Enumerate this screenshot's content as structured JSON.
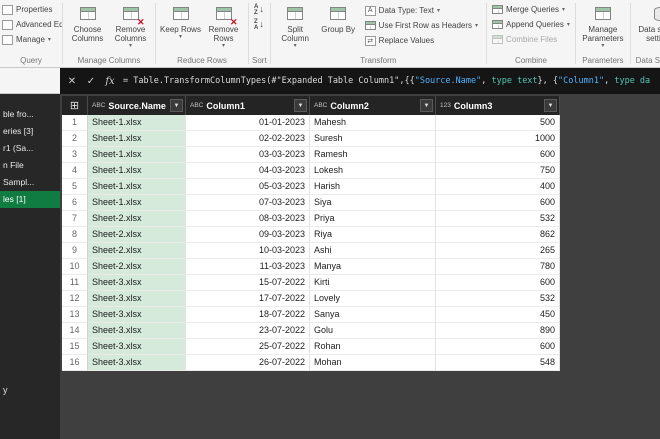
{
  "ribbon": {
    "query_group": {
      "label": "Query",
      "items": [
        {
          "label": "Properties"
        },
        {
          "label": "Advanced Editor"
        },
        {
          "label": "Manage",
          "dropdown": true
        }
      ]
    },
    "groups": [
      {
        "label": "Manage Columns",
        "buttons": [
          {
            "label": "Choose Columns"
          },
          {
            "label": "Remove Columns",
            "dropdown": true
          }
        ]
      },
      {
        "label": "Reduce Rows",
        "buttons": [
          {
            "label": "Keep Rows",
            "dropdown": true
          },
          {
            "label": "Remove Rows",
            "dropdown": true
          }
        ]
      },
      {
        "label": "Sort",
        "buttons": []
      },
      {
        "label": "Transform",
        "buttons": [
          {
            "label": "Split Column",
            "dropdown": true
          },
          {
            "label": "Group By"
          }
        ],
        "small_buttons": [
          {
            "label": "Data Type: Text",
            "dropdown": true
          },
          {
            "label": "Use First Row as Headers",
            "dropdown": true
          },
          {
            "label": "Replace Values"
          }
        ]
      },
      {
        "label": "Combine",
        "small_buttons": [
          {
            "label": "Merge Queries",
            "dropdown": true
          },
          {
            "label": "Append Queries",
            "dropdown": true
          },
          {
            "label": "Combine Files",
            "disabled": true
          }
        ]
      },
      {
        "label": "Parameters",
        "buttons": [
          {
            "label": "Manage Parameters",
            "dropdown": true
          }
        ]
      },
      {
        "label": "Data Sources",
        "buttons": [
          {
            "label": "Data source settings"
          }
        ]
      }
    ]
  },
  "formula_bar": {
    "fx_label": "fx",
    "parts": [
      {
        "style": "plain",
        "text": "= Table.TransformColumnTypes(#\"Expanded Table Column1\",{{"
      },
      {
        "style": "string",
        "text": "\"Source.Name\""
      },
      {
        "style": "plain",
        "text": ", "
      },
      {
        "style": "keyword",
        "text": "type text"
      },
      {
        "style": "plain",
        "text": "}, {"
      },
      {
        "style": "string",
        "text": "\"Column1\""
      },
      {
        "style": "plain",
        "text": ", "
      },
      {
        "style": "keyword",
        "text": "type da"
      }
    ]
  },
  "sidebar": {
    "items": [
      {
        "label": "ble fro...",
        "selected": false
      },
      {
        "label": "eries [3]",
        "selected": false
      },
      {
        "label": "r1 (Sa...",
        "selected": false
      },
      {
        "label": "n File",
        "selected": false
      },
      {
        "label": "Sampl...",
        "selected": false
      },
      {
        "label": "les [1]",
        "selected": true
      }
    ],
    "footer_text": "y"
  },
  "table": {
    "columns": [
      {
        "name": "Source.Name",
        "type_icon": "ABC",
        "align": "left",
        "selected": true
      },
      {
        "name": "Column1",
        "type_icon": "ABC",
        "align": "right",
        "selected": false
      },
      {
        "name": "Column2",
        "type_icon": "ABC",
        "align": "left",
        "selected": false
      },
      {
        "name": "Column3",
        "type_icon": "123",
        "align": "right",
        "selected": false
      }
    ],
    "rows": [
      {
        "n": "1",
        "cells": [
          "Sheet-1.xlsx",
          "01-01-2023",
          "Mahesh",
          "500"
        ]
      },
      {
        "n": "2",
        "cells": [
          "Sheet-1.xlsx",
          "02-02-2023",
          "Suresh",
          "1000"
        ]
      },
      {
        "n": "3",
        "cells": [
          "Sheet-1.xlsx",
          "03-03-2023",
          "Ramesh",
          "600"
        ]
      },
      {
        "n": "4",
        "cells": [
          "Sheet-1.xlsx",
          "04-03-2023",
          "Lokesh",
          "750"
        ]
      },
      {
        "n": "5",
        "cells": [
          "Sheet-1.xlsx",
          "05-03-2023",
          "Harish",
          "400"
        ]
      },
      {
        "n": "6",
        "cells": [
          "Sheet-1.xlsx",
          "07-03-2023",
          "Siya",
          "600"
        ]
      },
      {
        "n": "7",
        "cells": [
          "Sheet-2.xlsx",
          "08-03-2023",
          "Priya",
          "532"
        ]
      },
      {
        "n": "8",
        "cells": [
          "Sheet-2.xlsx",
          "09-03-2023",
          "Riya",
          "862"
        ]
      },
      {
        "n": "9",
        "cells": [
          "Sheet-2.xlsx",
          "10-03-2023",
          "Ashi",
          "265"
        ]
      },
      {
        "n": "10",
        "cells": [
          "Sheet-2.xlsx",
          "11-03-2023",
          "Manya",
          "780"
        ]
      },
      {
        "n": "11",
        "cells": [
          "Sheet-3.xlsx",
          "15-07-2022",
          "Kirti",
          "600"
        ]
      },
      {
        "n": "12",
        "cells": [
          "Sheet-3.xlsx",
          "17-07-2022",
          "Lovely",
          "532"
        ]
      },
      {
        "n": "13",
        "cells": [
          "Sheet-3.xlsx",
          "18-07-2022",
          "Sanya",
          "450"
        ]
      },
      {
        "n": "14",
        "cells": [
          "Sheet-3.xlsx",
          "23-07-2022",
          "Golu",
          "890"
        ]
      },
      {
        "n": "15",
        "cells": [
          "Sheet-3.xlsx",
          "25-07-2022",
          "Rohan",
          "600"
        ]
      },
      {
        "n": "16",
        "cells": [
          "Sheet-3.xlsx",
          "26-07-2022",
          "Mohan",
          "548"
        ]
      }
    ]
  },
  "colors": {
    "accent_green": "#107C41",
    "selected_column_bg": "#D5EADA",
    "grid_header_bg": "#242424",
    "formula_string": "#4FB3FF",
    "formula_keyword": "#4EC9B0"
  }
}
